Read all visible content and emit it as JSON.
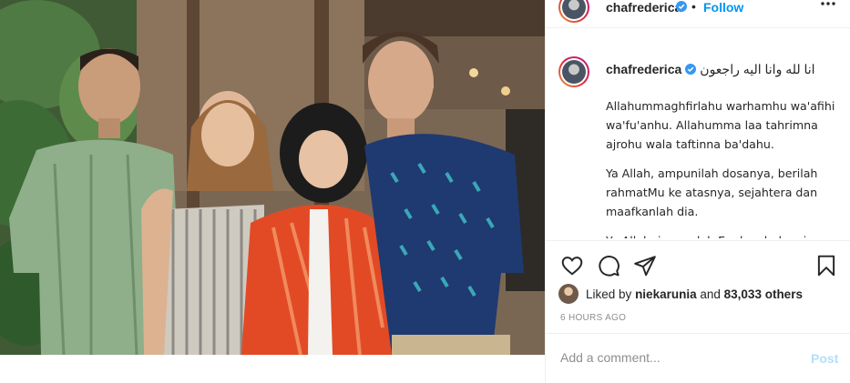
{
  "post": {
    "username": "chafrederica",
    "follow_label": "Follow",
    "dot": "•",
    "caption": {
      "title": "انا لله وانا اليه راجعون",
      "paragraphs": [
        "Allahummaghfirlahu warhamhu wa'afihi wa'fu'anhu. Allahumma laa tahrimna ajrohu wala taftinna ba'dahu.",
        "Ya Allah, ampunilah dosanya, berilah rahmatMu ke atasnya, sejahtera dan maafkanlah dia.",
        "Ya Allah, janganlah Engkau halangi"
      ]
    },
    "likes": {
      "prefix": "Liked by ",
      "user": "niekarunia",
      "middle": " and ",
      "count_text": "83,033 others"
    },
    "time_ago": "6 HOURS AGO",
    "comment": {
      "placeholder": "Add a comment...",
      "post_label": "Post"
    }
  },
  "colors": {
    "link_blue": "#0095f6",
    "post_disabled": "#b2dffc",
    "verified_blue": "#3897f0"
  },
  "icons": [
    "verified-badge-icon",
    "more-options-icon",
    "heart-icon",
    "comment-icon",
    "share-icon",
    "bookmark-icon"
  ]
}
